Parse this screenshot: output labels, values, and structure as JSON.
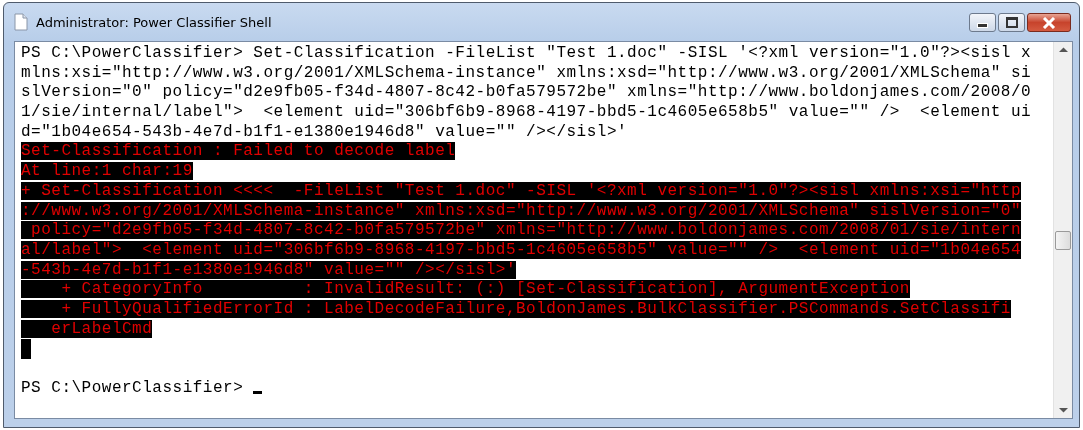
{
  "window": {
    "title": "Administrator: Power Classifier Shell"
  },
  "console": {
    "lines": [
      {
        "kind": "output",
        "text": "PS C:\\PowerClassifier> Set-Classification -FileList \"Test 1.doc\" -SISL '<?xml version=\"1.0\"?><sisl x"
      },
      {
        "kind": "output",
        "text": "mlns:xsi=\"http://www.w3.org/2001/XMLSchema-instance\" xmlns:xsd=\"http://www.w3.org/2001/XMLSchema\" si"
      },
      {
        "kind": "output",
        "text": "slVersion=\"0\" policy=\"d2e9fb05-f34d-4807-8c42-b0fa579572be\" xmlns=\"http://www.boldonjames.com/2008/0"
      },
      {
        "kind": "output",
        "text": "1/sie/internal/label\">  <element uid=\"306bf6b9-8968-4197-bbd5-1c4605e658b5\" value=\"\" />  <element ui"
      },
      {
        "kind": "output",
        "text": "d=\"1b04e654-543b-4e7d-b1f1-e1380e1946d8\" value=\"\" /></sisl>'"
      },
      {
        "kind": "error",
        "text": "Set-Classification : Failed to decode label"
      },
      {
        "kind": "error",
        "text": "At line:1 char:19"
      },
      {
        "kind": "error",
        "text": "+ Set-Classification <<<<  -FileList \"Test 1.doc\" -SISL '<?xml version=\"1.0\"?><sisl xmlns:xsi=\"http"
      },
      {
        "kind": "error",
        "text": "://www.w3.org/2001/XMLSchema-instance\" xmlns:xsd=\"http://www.w3.org/2001/XMLSchema\" sislVersion=\"0\""
      },
      {
        "kind": "error",
        "text": " policy=\"d2e9fb05-f34d-4807-8c42-b0fa579572be\" xmlns=\"http://www.boldonjames.com/2008/01/sie/intern"
      },
      {
        "kind": "error",
        "text": "al/label\">  <element uid=\"306bf6b9-8968-4197-bbd5-1c4605e658b5\" value=\"\" />  <element uid=\"1b04e654"
      },
      {
        "kind": "error",
        "text": "-543b-4e7d-b1f1-e1380e1946d8\" value=\"\" /></sisl>'"
      },
      {
        "kind": "error",
        "text": "    + CategoryInfo          : InvalidResult: (:) [Set-Classification], ArgumentException"
      },
      {
        "kind": "error",
        "text": "    + FullyQualifiedErrorId : LabelDecodeFailure,BoldonJames.BulkClassifier.PSCommands.SetClassifi"
      },
      {
        "kind": "error",
        "text": "   erLabelCmd"
      },
      {
        "kind": "error-blank"
      },
      {
        "kind": "blank"
      },
      {
        "kind": "prompt",
        "text": "PS C:\\PowerClassifier> "
      }
    ]
  }
}
